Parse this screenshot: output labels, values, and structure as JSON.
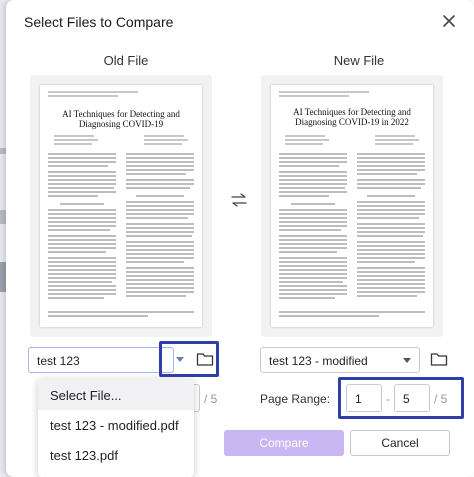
{
  "dialog": {
    "title": "Select Files to Compare",
    "close_icon": "close-icon"
  },
  "old_file": {
    "column_label": "Old File",
    "page_title": "AI Techniques for Detecting and Diagnosing COVID-19",
    "selected_file": "test 123",
    "page_range_total": "/ 5"
  },
  "new_file": {
    "column_label": "New File",
    "page_title": "AI Techniques for Detecting and Diagnosing COVID-19 in 2022",
    "selected_file": "test 123 - modified",
    "page_range_label": "Page Range:",
    "range_start": "1",
    "range_separator": "-",
    "range_end": "5",
    "page_range_total": "/ 5"
  },
  "dropdown": {
    "options": [
      "Select File...",
      "test 123 - modified.pdf",
      "test 123.pdf"
    ]
  },
  "footer": {
    "compare_label": "Compare",
    "cancel_label": "Cancel"
  },
  "colors": {
    "accent": "#c9b7f3",
    "highlight": "#2f3fa8"
  }
}
